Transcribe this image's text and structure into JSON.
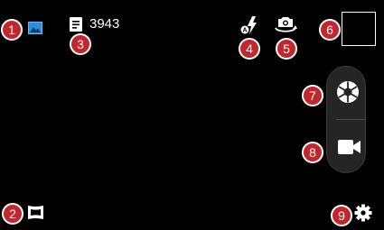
{
  "status": {
    "remaining_photos": "3943"
  },
  "icons": {
    "gallery_mode": "image-icon",
    "storage": "document-icon",
    "flash": "flash-auto-icon",
    "switch_camera": "camera-switch-icon",
    "panorama": "panorama-icon",
    "shutter": "aperture-icon",
    "video": "video-camera-icon",
    "settings": "gear-icon"
  },
  "callouts": [
    "1",
    "2",
    "3",
    "4",
    "5",
    "6",
    "7",
    "8",
    "9"
  ],
  "colors": {
    "background": "#000000",
    "badge": "#c2272d",
    "gallery_icon": "#2a8fd6",
    "pill": "#252526"
  }
}
